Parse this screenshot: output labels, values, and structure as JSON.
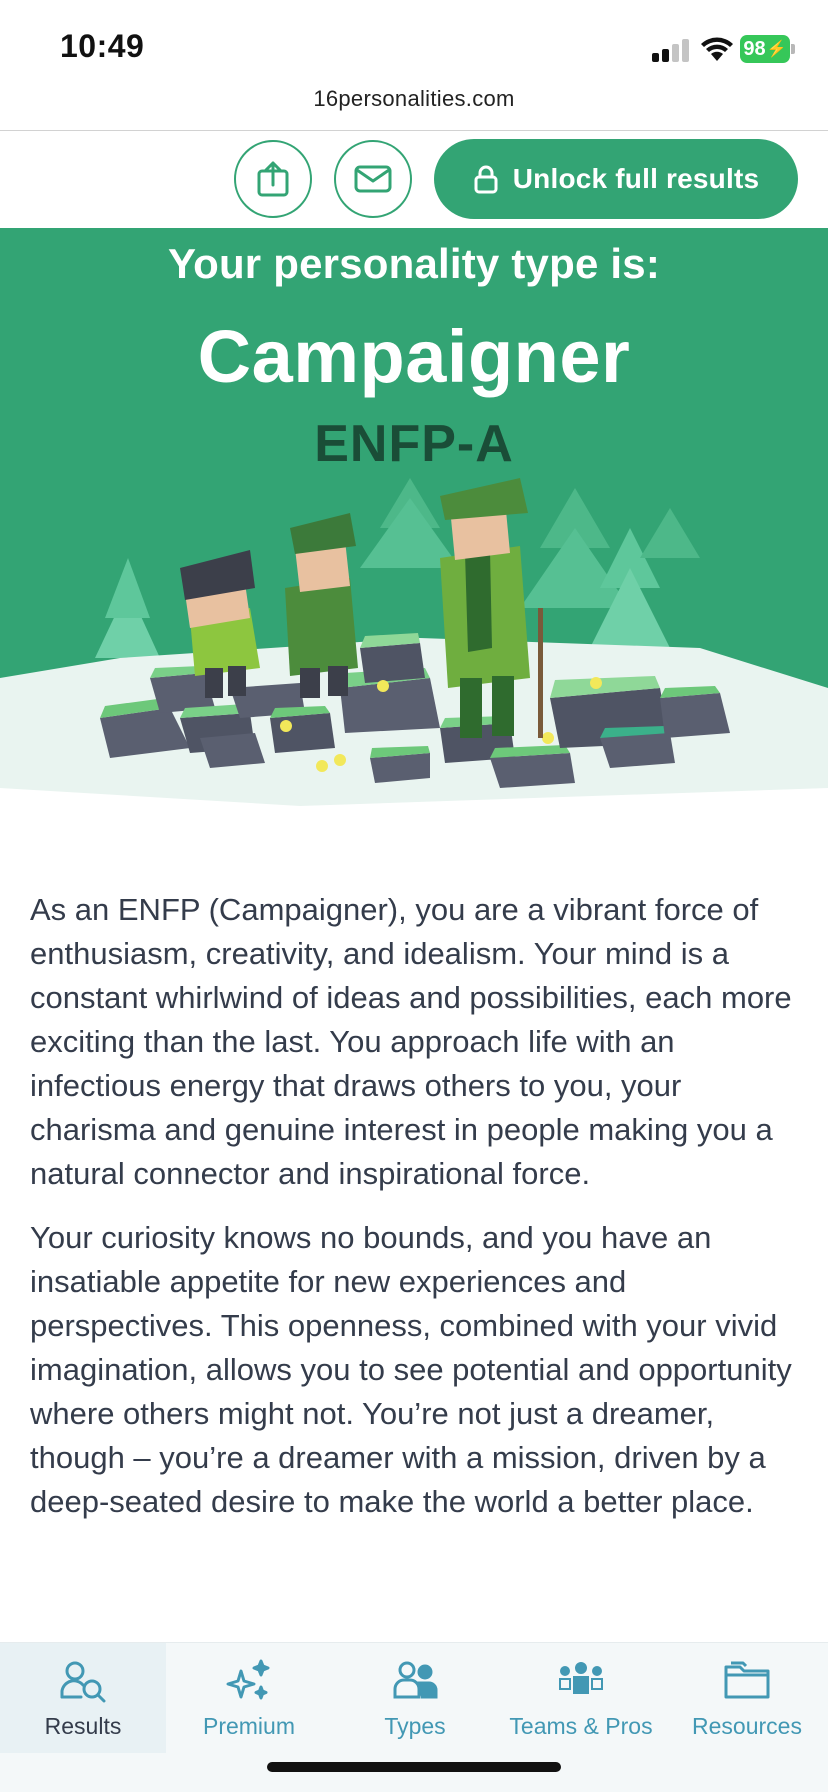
{
  "status_bar": {
    "time": "10:49",
    "battery": "98"
  },
  "browser": {
    "url": "16personalities.com"
  },
  "header": {
    "unlock_label": "Unlock full results"
  },
  "hero": {
    "intro": "Your personality type is:",
    "type_name": "Campaigner",
    "type_code": "ENFP-A"
  },
  "content": {
    "paragraphs": [
      "As an ENFP (Campaigner), you are a vibrant force of enthusiasm, creativity, and idealism. Your mind is a constant whirlwind of ideas and possibilities, each more exciting than the last. You approach life with an infectious energy that draws others to you, your charisma and genuine interest in people making you a natural connector and inspirational force.",
      "Your curiosity knows no bounds, and you have an insatiable appetite for new experiences and perspectives. This openness, combined with your vivid imagination, allows you to see potential and opportunity where others might not. You’re not just a dreamer, though – you’re a dreamer with a mission, driven by a deep-seated desire to make the world a better place."
    ]
  },
  "bottom_nav": {
    "items": [
      {
        "label": "Results",
        "icon": "results-icon",
        "active": true
      },
      {
        "label": "Premium",
        "icon": "sparkles-icon",
        "active": false
      },
      {
        "label": "Types",
        "icon": "types-icon",
        "active": false
      },
      {
        "label": "Teams & Pros",
        "icon": "teams-icon",
        "active": false
      },
      {
        "label": "Resources",
        "icon": "folder-icon",
        "active": false
      }
    ]
  },
  "colors": {
    "brand_green": "#33a474",
    "dark_green": "#1a4d37",
    "nav_blue": "#4298b4",
    "text": "#343c4b"
  }
}
